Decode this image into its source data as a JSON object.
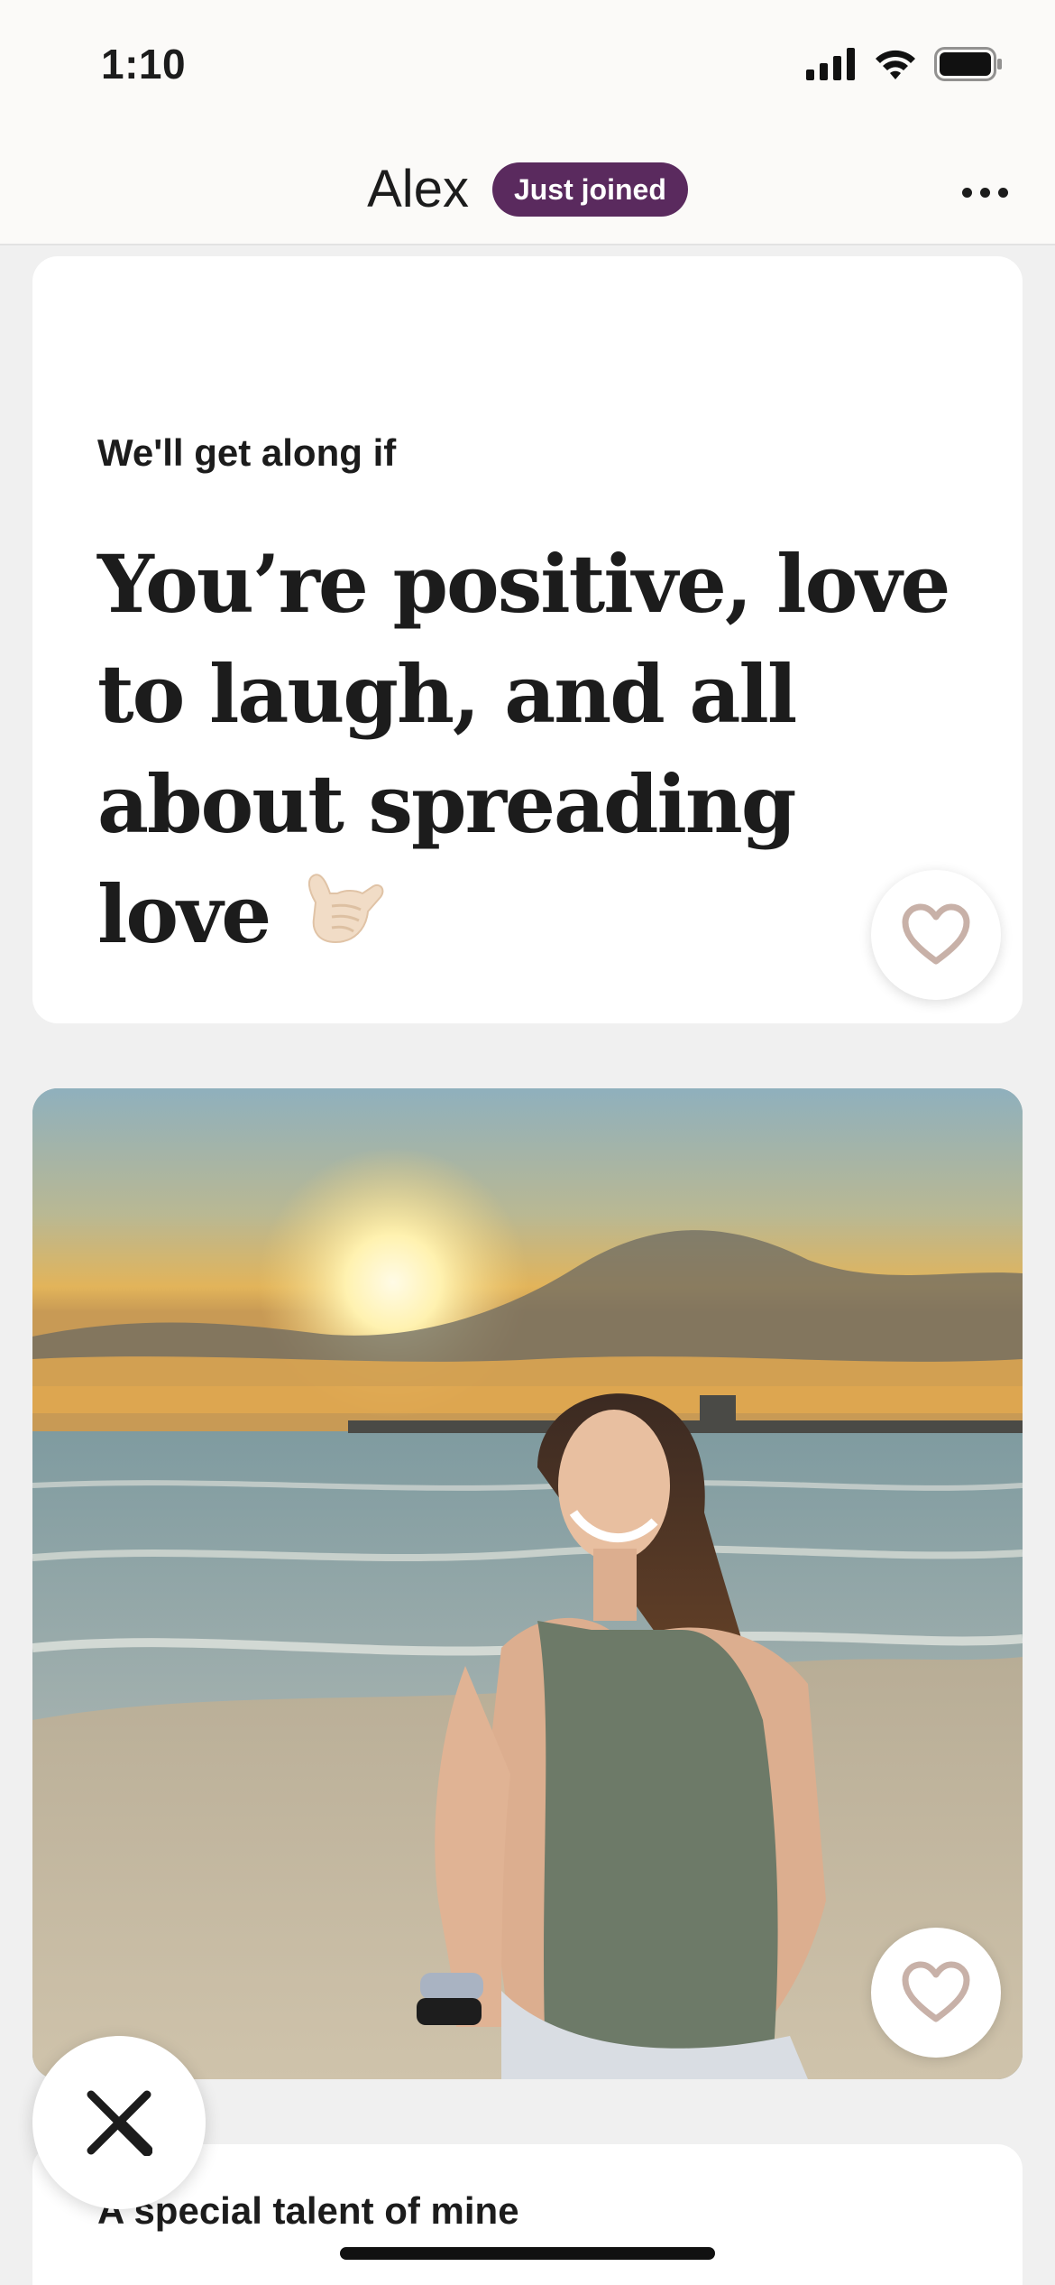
{
  "status_bar": {
    "time": "1:10",
    "icons": [
      "cellular-signal-icon",
      "wifi-icon",
      "battery-icon"
    ]
  },
  "header": {
    "name": "Alex",
    "badge": "Just joined",
    "more_icon": "more-horizontal-icon"
  },
  "prompt_card": {
    "prompt": "We'll get along if",
    "answer": "You’re positive, love to laugh, and all about spreading love",
    "emoji": "call-me-hand-emoji",
    "like_icon": "heart-outline-icon"
  },
  "photo_card": {
    "description_icon": "profile-photo",
    "like_icon": "heart-outline-icon"
  },
  "next_card": {
    "prompt": "A special talent of mine"
  },
  "skip": {
    "icon": "close-icon"
  },
  "colors": {
    "badge_bg": "#5a2a5e",
    "heart_outline": "#c8b1a8",
    "background": "#f0f0f0"
  }
}
